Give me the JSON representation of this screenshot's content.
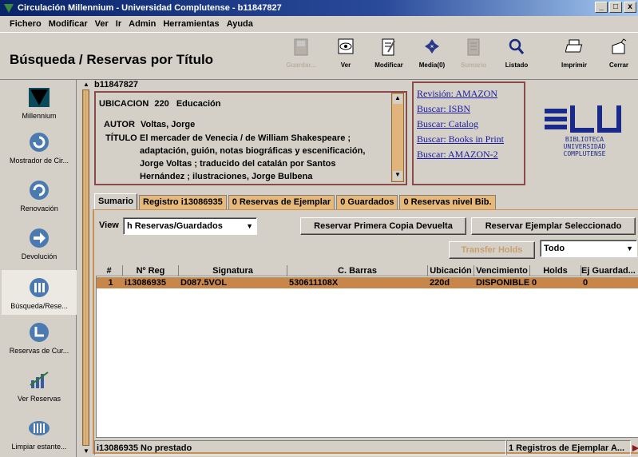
{
  "window": {
    "title": "Circulación Millennium - Universidad Complutense - b11847827",
    "min": "_",
    "max": "□",
    "close": "x"
  },
  "menu": [
    "Fichero",
    "Modificar",
    "Ver",
    "Ir",
    "Admin",
    "Herramientas",
    "Ayuda"
  ],
  "page_title": "Búsqueda / Reservas por Título",
  "toolbar": [
    {
      "label": "Guardar...",
      "icon": "save-icon",
      "enabled": false
    },
    {
      "label": "Ver",
      "icon": "view-icon",
      "enabled": true
    },
    {
      "label": "Modificar",
      "icon": "edit-icon",
      "enabled": true
    },
    {
      "label": "Media(0)",
      "icon": "media-icon",
      "enabled": true
    },
    {
      "label": "Sumario",
      "icon": "summary-icon",
      "enabled": false
    },
    {
      "label": "Listado",
      "icon": "search-icon",
      "enabled": true
    },
    {
      "label": "Imprimir",
      "icon": "print-icon",
      "enabled": true
    },
    {
      "label": "Cerrar",
      "icon": "close-icon",
      "enabled": true
    }
  ],
  "nav": [
    {
      "label": "Millennium",
      "icon": "millennium-icon"
    },
    {
      "label": "Mostrador de Cir...",
      "icon": "circulation-desk-icon"
    },
    {
      "label": "Renovación",
      "icon": "renew-icon"
    },
    {
      "label": "Devolución",
      "icon": "return-icon"
    },
    {
      "label": "Búsqueda/Rese...",
      "icon": "search-holds-icon"
    },
    {
      "label": "Reservas de Cur...",
      "icon": "course-reserves-icon"
    },
    {
      "label": "Ver Reservas",
      "icon": "view-holds-icon"
    },
    {
      "label": "Limpiar estante...",
      "icon": "clear-shelf-icon"
    }
  ],
  "record": {
    "id": "b11847827",
    "ubicacion_label": "UBICACION",
    "ubicacion_code": "220",
    "ubicacion_name": "Educación",
    "autor_label": "AUTOR",
    "autor": "Voltas, Jorge",
    "titulo_label": "TÍTULO",
    "titulo_lines": [
      "El mercader de Venecia / de William Shakespeare ;",
      "adaptación, guión, notas biográficas y escenificación,",
      "Jorge Voltas ; traducido del catalán por Santos",
      "Hernández ; ilustraciones, Jorge Bulbena"
    ]
  },
  "links": [
    "Revisión: AMAZON",
    "Buscar: ISBN",
    "Buscar: Catalog",
    "Buscar: Books in Print",
    "Buscar: AMAZON-2"
  ],
  "logo": {
    "line1": "BIBLIOTECA",
    "line2": "UNIVERSIDAD",
    "line3": "COMPLUTENSE"
  },
  "tabs": [
    "Sumario",
    "Registro i13086935",
    "0 Reservas de Ejemplar",
    "0 Guardados",
    "0 Reservas nivel Bib."
  ],
  "controls": {
    "view_label": "View",
    "view_value": "h Reservas/Guardados",
    "reserve_first": "Reservar Primera Copia Devuelta",
    "reserve_selected": "Reservar Ejemplar Seleccionado",
    "transfer_holds": "Transfer Holds",
    "filter_value": "Todo"
  },
  "grid": {
    "columns": [
      "#",
      "Nº Reg",
      "Signatura",
      "C. Barras",
      "Ubicación",
      "Vencimiento",
      "Holds",
      "Ej Guardad..."
    ],
    "rows": [
      [
        "1",
        "i13086935",
        "D087.5VOL",
        "530611108X",
        "220d",
        "DISPONIBLE",
        "0",
        "0"
      ]
    ]
  },
  "status": {
    "left": "i13086935 No prestado",
    "right": "1 Registros de Ejemplar A..."
  },
  "colors": {
    "accent": "#e0b47a",
    "border": "#8b4a4a",
    "selected_row": "#c8864a",
    "link": "#1a1aa0"
  }
}
